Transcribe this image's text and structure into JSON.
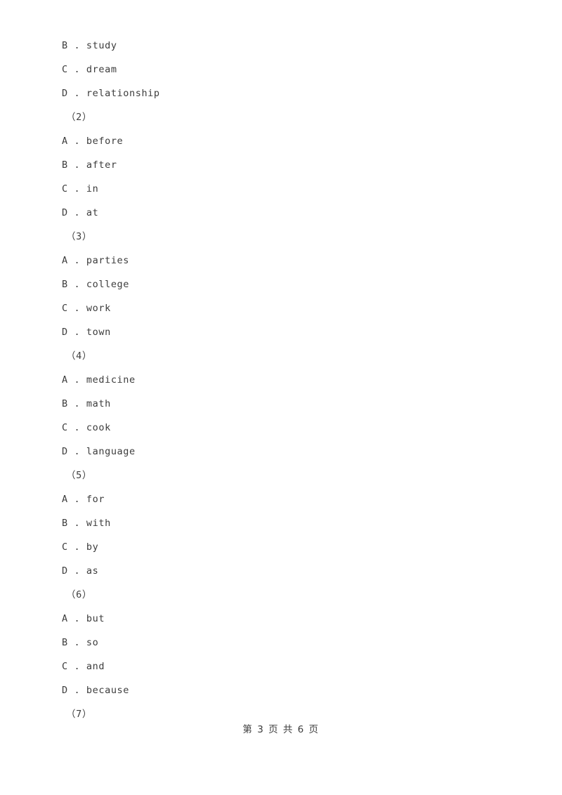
{
  "document": {
    "background_color": "#ffffff",
    "text_color": "#3c3c3c",
    "lines": [
      {
        "type": "option",
        "text": "B . study"
      },
      {
        "type": "option",
        "text": "C . dream"
      },
      {
        "type": "option",
        "text": "D . relationship"
      },
      {
        "type": "qnum",
        "text": "（2）"
      },
      {
        "type": "option",
        "text": "A . before"
      },
      {
        "type": "option",
        "text": "B . after"
      },
      {
        "type": "option",
        "text": "C . in"
      },
      {
        "type": "option",
        "text": "D . at"
      },
      {
        "type": "qnum",
        "text": "（3）"
      },
      {
        "type": "option",
        "text": "A . parties"
      },
      {
        "type": "option",
        "text": "B . college"
      },
      {
        "type": "option",
        "text": "C . work"
      },
      {
        "type": "option",
        "text": "D . town"
      },
      {
        "type": "qnum",
        "text": "（4）"
      },
      {
        "type": "option",
        "text": "A . medicine"
      },
      {
        "type": "option",
        "text": "B . math"
      },
      {
        "type": "option",
        "text": "C . cook"
      },
      {
        "type": "option",
        "text": "D . language"
      },
      {
        "type": "qnum",
        "text": "（5）"
      },
      {
        "type": "option",
        "text": "A . for"
      },
      {
        "type": "option",
        "text": "B . with"
      },
      {
        "type": "option",
        "text": "C . by"
      },
      {
        "type": "option",
        "text": "D . as"
      },
      {
        "type": "qnum",
        "text": "（6）"
      },
      {
        "type": "option",
        "text": "A . but"
      },
      {
        "type": "option",
        "text": "B . so"
      },
      {
        "type": "option",
        "text": "C . and"
      },
      {
        "type": "option",
        "text": "D . because"
      },
      {
        "type": "qnum",
        "text": "（7）"
      }
    ]
  },
  "footer": {
    "page_label": "第 3 页 共 6 页",
    "current_page": 3,
    "total_pages": 6
  }
}
